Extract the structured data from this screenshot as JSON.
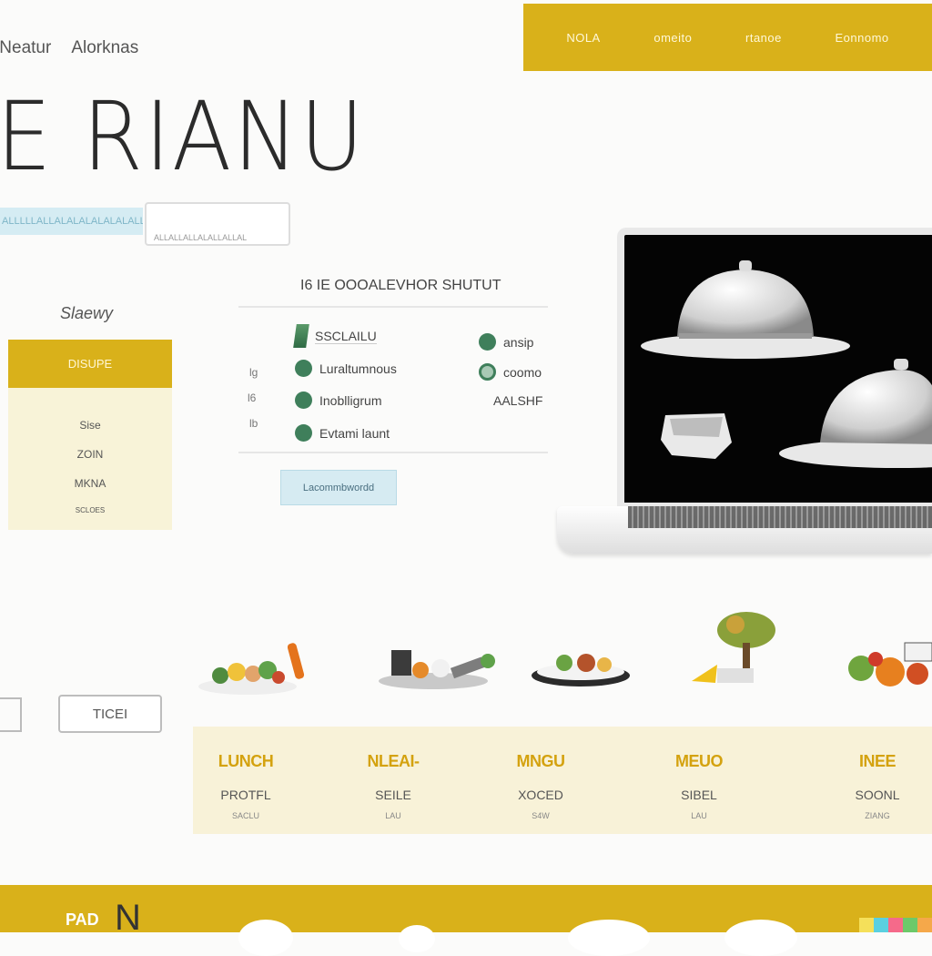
{
  "header": {
    "left_links": [
      "INeatur",
      "Alorknas"
    ],
    "nav_items": [
      "NOLA",
      "omeito",
      "rtanoe",
      "Eonnomo"
    ]
  },
  "brand": {
    "title": "E RIANU"
  },
  "search": {
    "banner_text": "ALLLLLALLALALALALALALALLLAALLALALALALA",
    "placeholder": "ALLALLALLALALLALLAL"
  },
  "side_menu": {
    "title": "Slaewy",
    "header": "DISUPE",
    "items": [
      "Sise",
      "ZOIN",
      "MKNA",
      "SCLOES"
    ]
  },
  "menu": {
    "heading": "I6 IE OOOALEVHOR SHUTUT",
    "left_items": [
      "SSCLAILU",
      "Luraltumnous",
      "Inoblligrum",
      "Evtami launt"
    ],
    "right_items": [
      "ansip",
      "coomo",
      "AALSHF"
    ],
    "side_numbers": [
      "lg",
      "l6",
      "lb"
    ],
    "order_button": "Lacommbwordd"
  },
  "reserve_button": "TICEI",
  "categories": [
    {
      "title": "LUNCH",
      "label": "PROTFL",
      "sub": "SACLU"
    },
    {
      "title": "NLEAI-",
      "label": "SEILE",
      "sub": "LAU"
    },
    {
      "title": "MNGU",
      "label": "XOCED",
      "sub": "S4W"
    },
    {
      "title": "MEUO",
      "label": "SIBEL",
      "sub": "LAU"
    },
    {
      "title": "INEE",
      "label": "SOONL",
      "sub": "ZIANG"
    }
  ],
  "footer": {
    "logo": "PAD",
    "letter": "N"
  },
  "colors": {
    "accent": "#d9b11a",
    "green": "#3f7f5b",
    "pale_blue": "#d6ebf2"
  }
}
